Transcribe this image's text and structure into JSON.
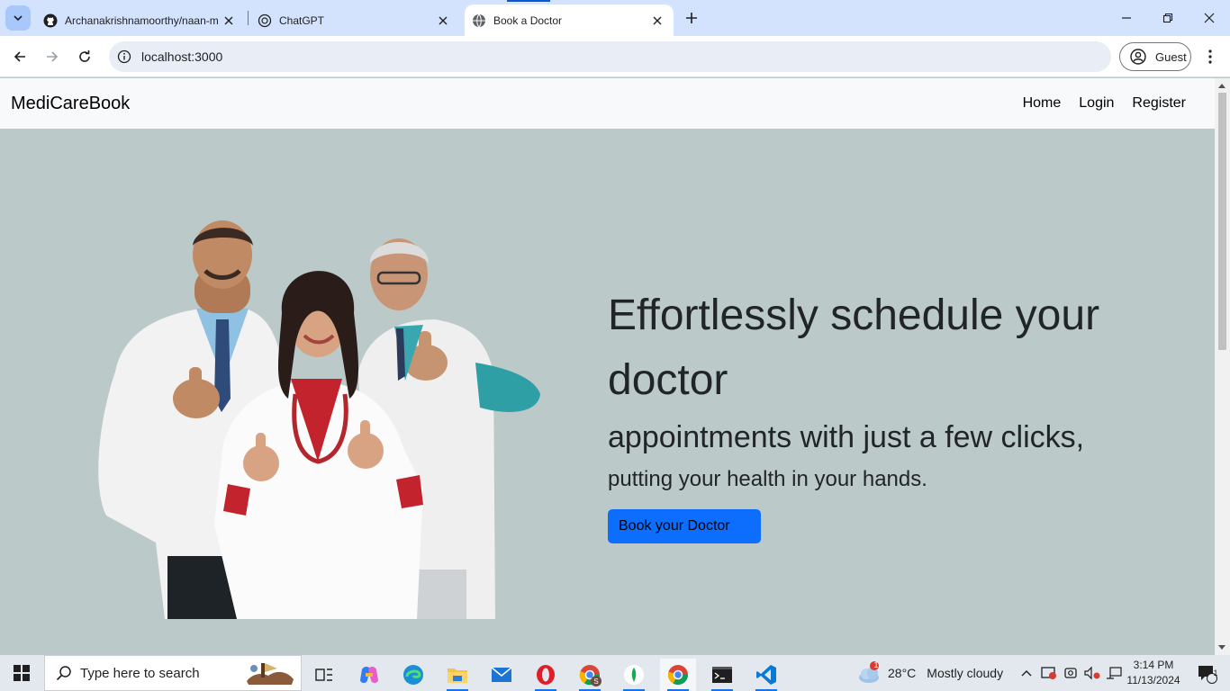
{
  "browser": {
    "tabs": [
      {
        "title": "Archanakrishnamoorthy/naan-m",
        "icon": "github-icon",
        "active": false
      },
      {
        "title": "ChatGPT",
        "icon": "chatgpt-icon",
        "active": false
      },
      {
        "title": "Book a Doctor",
        "icon": "globe-icon",
        "active": true
      }
    ],
    "url": "localhost:3000",
    "profile_label": "Guest"
  },
  "site": {
    "brand": "MediCareBook",
    "nav": {
      "home": "Home",
      "login": "Login",
      "register": "Register"
    },
    "hero": {
      "headline": "Effortlessly schedule your doctor",
      "subheadline": "appointments with just a few clicks,",
      "tagline": "putting your health in your hands.",
      "cta_label": "Book your Doctor",
      "image_alt": "doctors-giving-thumbs-up"
    },
    "colors": {
      "hero_bg": "#bcc9c9",
      "cta": "#0d6efd",
      "nav_bg": "#f8f9fa"
    }
  },
  "taskbar": {
    "search_placeholder": "Type here to search",
    "weather": {
      "temp": "28°C",
      "condition": "Mostly cloudy",
      "badge": "1"
    },
    "time": "3:14 PM",
    "date": "11/13/2024",
    "notification_count": "1"
  }
}
